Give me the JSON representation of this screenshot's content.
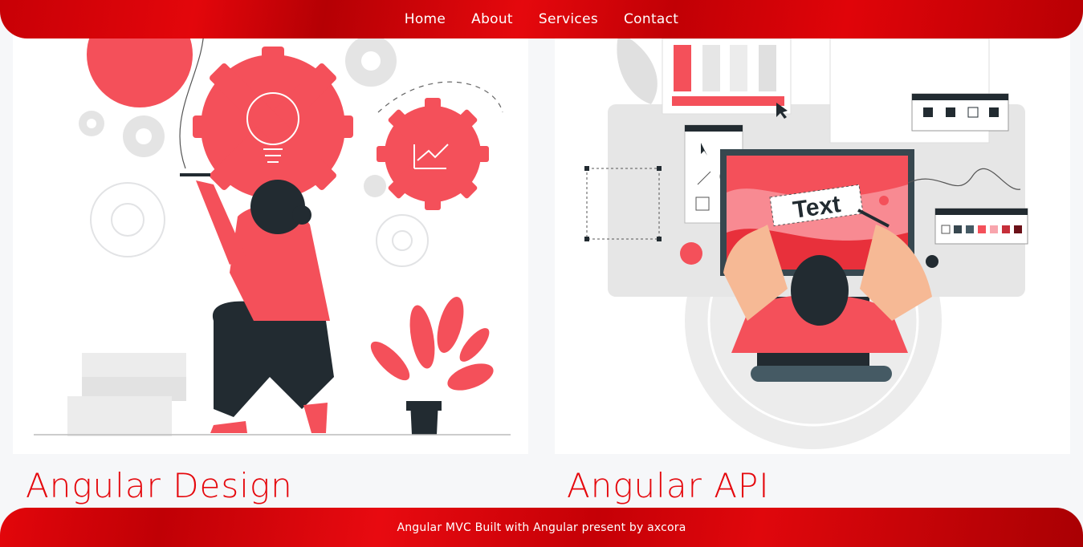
{
  "nav": {
    "items": [
      {
        "label": "Home"
      },
      {
        "label": "About"
      },
      {
        "label": "Services"
      },
      {
        "label": "Contact"
      }
    ]
  },
  "cards": [
    {
      "title": "Angular Design",
      "image": "illustration-woman-drawing-gears"
    },
    {
      "title": "Angular API",
      "image": "illustration-woman-editing-text-on-screen"
    }
  ],
  "footer": {
    "text": "Angular MVC Built with Angular present by axcora"
  },
  "colors": {
    "brand_red": "#e5080d",
    "accent_coral": "#f4505a",
    "dark": "#222b31",
    "page_bg": "#f6f7f9"
  },
  "illustration": {
    "text_label": "Text"
  }
}
